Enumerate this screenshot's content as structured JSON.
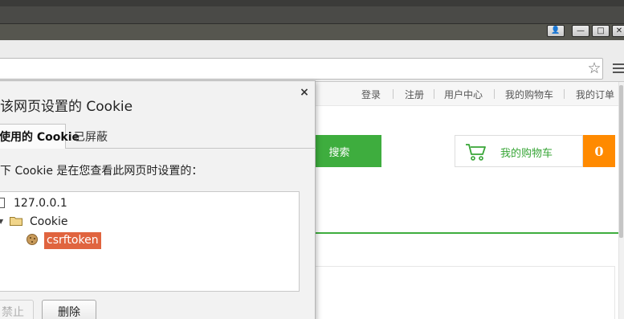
{
  "dialog": {
    "title": "该网页设置的 Cookie",
    "close_glyph": "×",
    "tabs": [
      {
        "label": "使用的 Cookie",
        "active": true
      },
      {
        "label": "已屏蔽",
        "active": false
      }
    ],
    "description": "下 Cookie 是在您查看此网页时设置的：",
    "tree": {
      "host": "127.0.0.1",
      "folder": "Cookie",
      "cookie": "csrftoken"
    },
    "buttons": {
      "block_label": "禁止",
      "delete_label": "删除"
    }
  },
  "page": {
    "topnav": [
      "登录",
      "注册",
      "用户中心",
      "我的购物车",
      "我的订单"
    ],
    "search_button": "搜索",
    "cart_label": "我的购物车",
    "cart_count": "0"
  },
  "window": {
    "user_glyph": "👤",
    "minimize_glyph": "—",
    "maximize_glyph": "□",
    "close_glyph": "✕"
  },
  "toolbar": {
    "bookmark_glyph": "☆"
  },
  "colors": {
    "accent_green": "#3ead3e",
    "cart_count_orange": "#ff8a00",
    "selection": "#e0643f"
  }
}
